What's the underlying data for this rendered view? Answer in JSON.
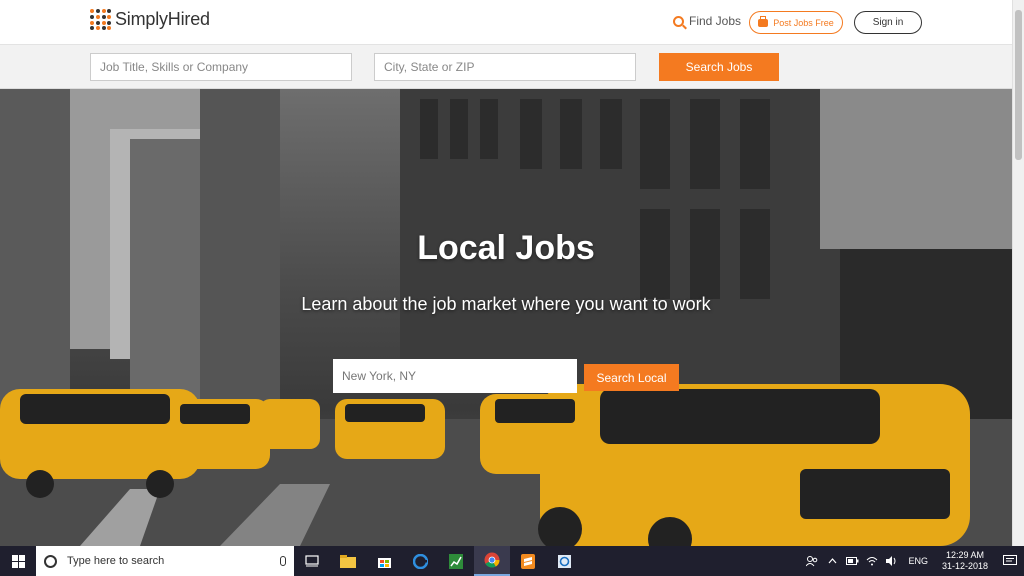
{
  "header": {
    "logo_text": "SimplyHired",
    "find_jobs": "Find Jobs",
    "post_jobs": "Post Jobs Free",
    "sign_in": "Sign in"
  },
  "search": {
    "job_placeholder": "Job Title, Skills or Company",
    "location_placeholder": "City, State or ZIP",
    "button": "Search Jobs"
  },
  "hero": {
    "title": "Local Jobs",
    "subtitle": "Learn about the job market where you want to work",
    "location_placeholder": "New York, NY",
    "button": "Search Local"
  },
  "taskbar": {
    "search_placeholder": "Type here to search",
    "apps": [
      "task-view-icon",
      "file-explorer-icon",
      "store-icon",
      "edge-icon",
      "spreadsheet-icon",
      "chrome-icon",
      "sublime-icon",
      "snipping-icon"
    ],
    "active_app": "chrome-icon",
    "language": "ENG",
    "time": "12:29 AM",
    "date": "31-12-2018"
  },
  "colors": {
    "accent": "#f47a20",
    "taskbar": "#1f1f2e"
  }
}
